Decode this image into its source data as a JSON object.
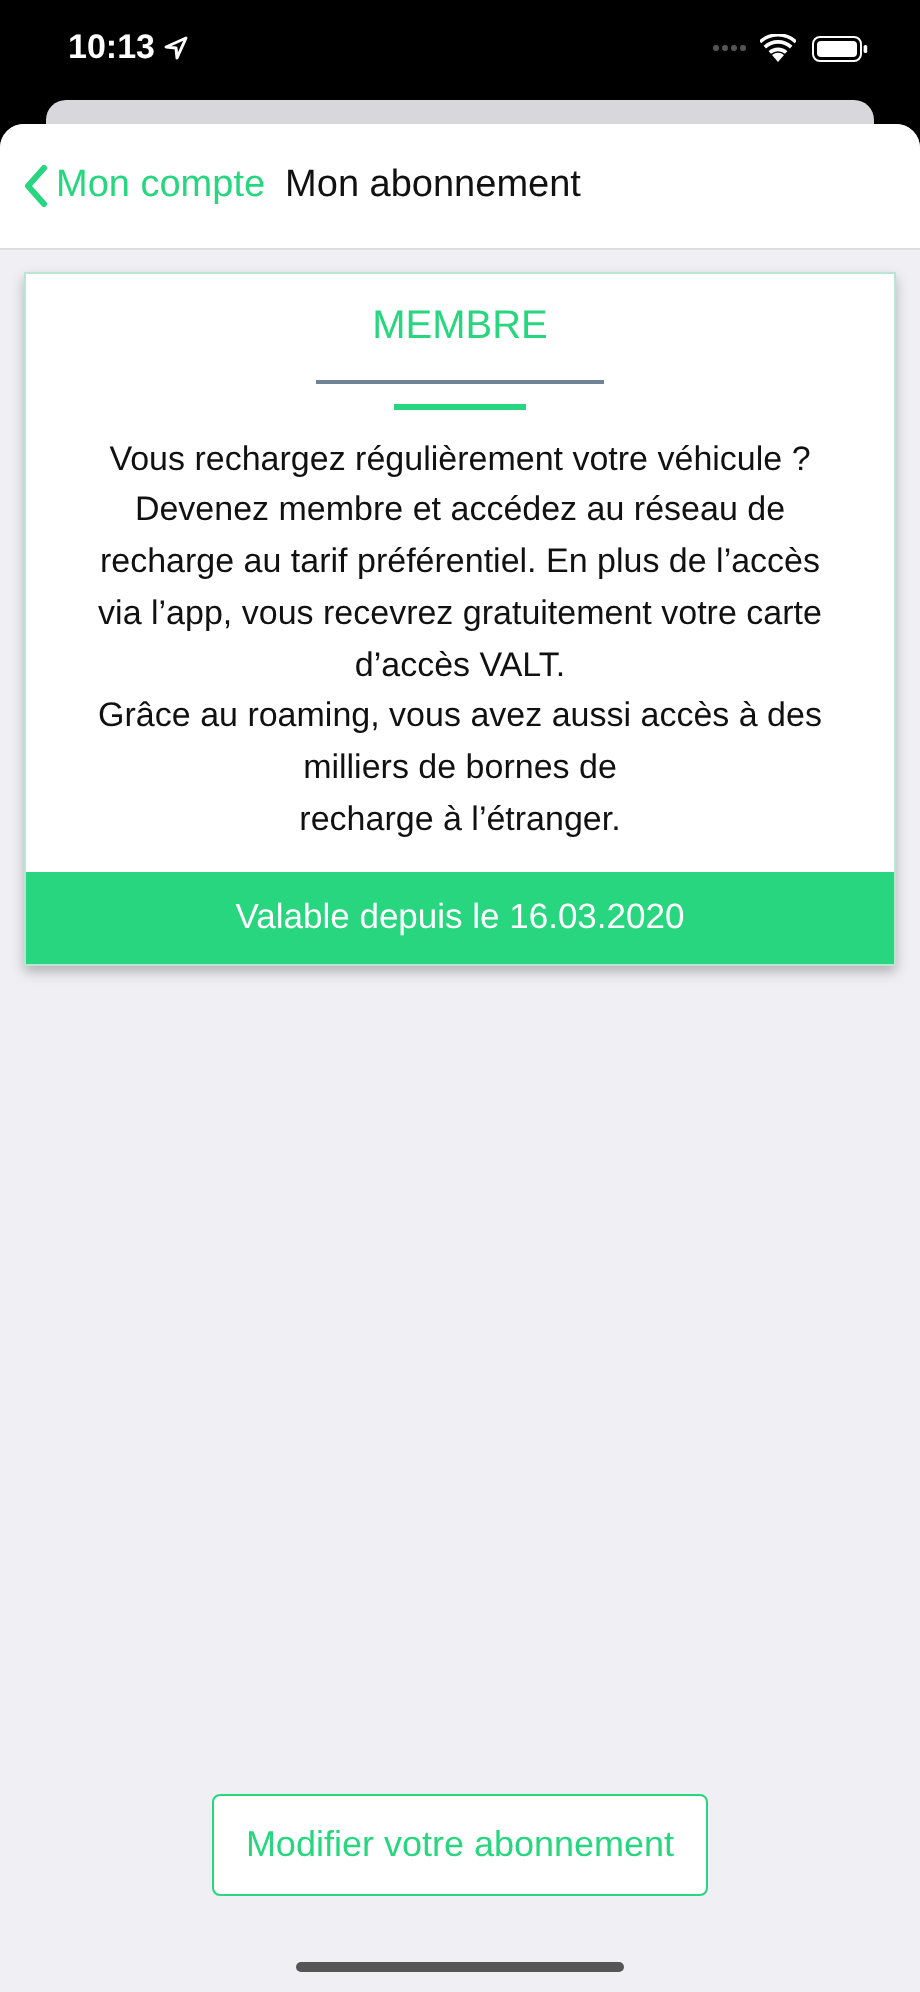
{
  "status_bar": {
    "time": "10:13"
  },
  "nav": {
    "back_label": "Mon compte",
    "title": "Mon abonnement"
  },
  "card": {
    "title": "MEMBRE",
    "description_lines": [
      "Vous rechargez régulièrement votre véhicule ?",
      "Devenez membre et accédez au réseau de",
      "recharge au tarif préférentiel. En plus de l’accès",
      "via l’app, vous recevrez gratuitement votre carte",
      "d’accès VALT.",
      "Grâce au roaming, vous avez aussi accès à des",
      "milliers de bornes de",
      "recharge à l’étranger."
    ],
    "footer": "Valable depuis le 16.03.2020"
  },
  "button": {
    "label": "Modifier votre abonnement"
  }
}
